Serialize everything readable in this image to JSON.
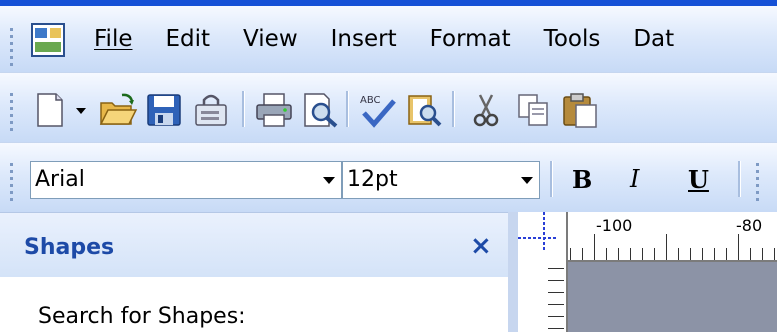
{
  "menubar": {
    "items": [
      "File",
      "Edit",
      "View",
      "Insert",
      "Format",
      "Tools",
      "Dat"
    ]
  },
  "standard_toolbar": {
    "buttons": [
      "new-icon",
      "dropdown-arrow",
      "open-icon",
      "save-icon",
      "permission-icon",
      "print-icon",
      "print-preview-icon",
      "spelling-icon",
      "research-icon",
      "cut-icon",
      "copy-icon",
      "paste-icon"
    ]
  },
  "format_toolbar": {
    "font_name": "Arial",
    "font_size": "12pt",
    "bold_label": "B",
    "italic_label": "I",
    "underline_label": "U"
  },
  "shapes_panel": {
    "title": "Shapes",
    "close_label": "×",
    "search_label": "Search for Shapes:"
  },
  "ruler": {
    "labels": [
      "-100",
      "-80"
    ]
  },
  "colors": {
    "accent": "#1651d6",
    "panel_title": "#1d4aa7",
    "canvas": "#8c93a6"
  }
}
